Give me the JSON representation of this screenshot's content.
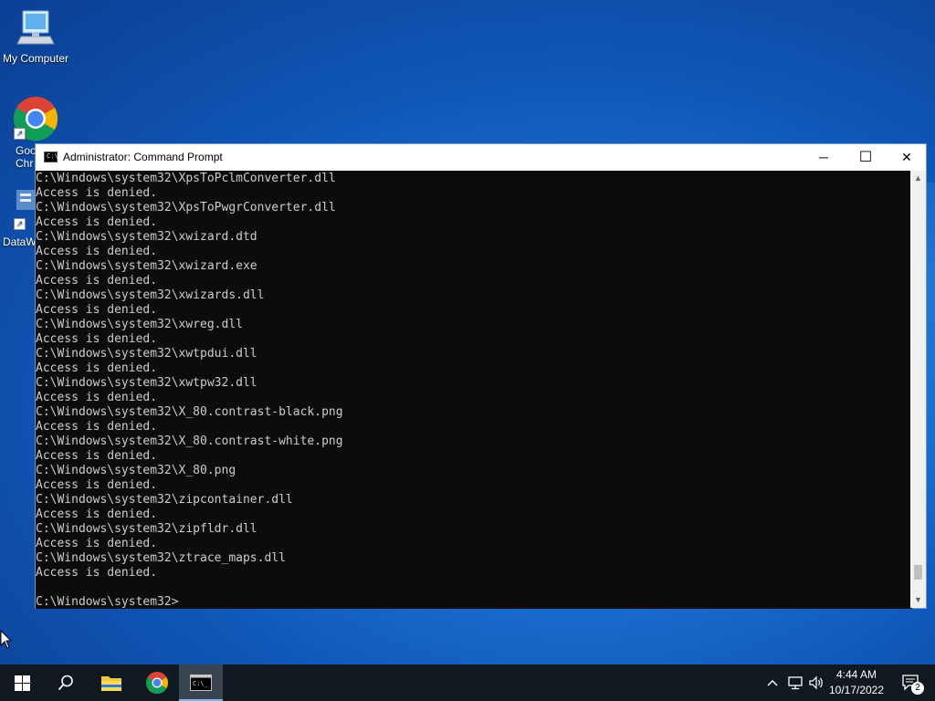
{
  "desktop": {
    "icons": [
      {
        "label": "My Computer"
      },
      {
        "label": "Google Chrome",
        "visible_label": "Goo\nChr"
      },
      {
        "label": "DataW",
        "visible_label": "DataW"
      }
    ]
  },
  "window": {
    "title": "Administrator: Command Prompt",
    "console_lines": [
      "C:\\Windows\\system32\\XpsToPclmConverter.dll",
      "Access is denied.",
      "C:\\Windows\\system32\\XpsToPwgrConverter.dll",
      "Access is denied.",
      "C:\\Windows\\system32\\xwizard.dtd",
      "Access is denied.",
      "C:\\Windows\\system32\\xwizard.exe",
      "Access is denied.",
      "C:\\Windows\\system32\\xwizards.dll",
      "Access is denied.",
      "C:\\Windows\\system32\\xwreg.dll",
      "Access is denied.",
      "C:\\Windows\\system32\\xwtpdui.dll",
      "Access is denied.",
      "C:\\Windows\\system32\\xwtpw32.dll",
      "Access is denied.",
      "C:\\Windows\\system32\\X_80.contrast-black.png",
      "Access is denied.",
      "C:\\Windows\\system32\\X_80.contrast-white.png",
      "Access is denied.",
      "C:\\Windows\\system32\\X_80.png",
      "Access is denied.",
      "C:\\Windows\\system32\\zipcontainer.dll",
      "Access is denied.",
      "C:\\Windows\\system32\\zipfldr.dll",
      "Access is denied.",
      "C:\\Windows\\system32\\ztrace_maps.dll",
      "Access is denied.",
      "",
      "C:\\Windows\\system32>"
    ],
    "buttons": {
      "minimize": "─",
      "maximize": "☐",
      "close": "✕"
    }
  },
  "taskbar": {
    "items": [
      {
        "name": "start",
        "icon": "windows-logo-icon"
      },
      {
        "name": "search",
        "icon": "search-icon"
      },
      {
        "name": "file-explorer",
        "icon": "folder-icon"
      },
      {
        "name": "chrome",
        "icon": "chrome-icon"
      },
      {
        "name": "command-prompt",
        "icon": "cmd-icon",
        "active": true
      }
    ],
    "clock": {
      "time": "4:44 AM",
      "date": "10/17/2022"
    },
    "notification_count": "2"
  },
  "colors": {
    "accent": "#76b9ed",
    "taskbar": "#101820",
    "console_bg": "#0c0c0c",
    "console_fg": "#cccccc"
  }
}
